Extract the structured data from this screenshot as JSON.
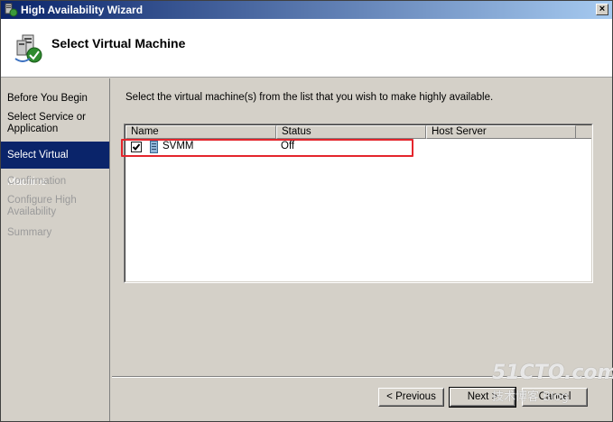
{
  "window": {
    "title": "High Availability Wizard",
    "close_glyph": "×"
  },
  "header": {
    "title": "Select Virtual Machine",
    "icon": "wizard-server-icon"
  },
  "sidebar": {
    "items": [
      {
        "label": "Before You Begin",
        "state": "normal"
      },
      {
        "label": "Select Service or Application",
        "state": "normal"
      },
      {
        "label": "Select Virtual Machine",
        "state": "active"
      },
      {
        "label": "Confirmation",
        "state": "disabled"
      },
      {
        "label": "Configure High Availability",
        "state": "disabled"
      },
      {
        "label": "Summary",
        "state": "disabled"
      }
    ]
  },
  "main": {
    "instruction": "Select the virtual machine(s) from the list that you wish to make highly available.",
    "list": {
      "columns": [
        "Name",
        "Status",
        "Host Server"
      ],
      "rows": [
        {
          "checked": true,
          "name": "SVMM",
          "status": "Off",
          "host_server": ""
        }
      ]
    }
  },
  "buttons": {
    "previous": "< Previous",
    "next": "Next >",
    "cancel": "Cancel"
  },
  "watermark": {
    "logo": "51CTO.com",
    "sub": "技术博客  Blog"
  },
  "colors": {
    "accent": "#0a246a",
    "highlight_box": "#e4252c",
    "window_bg": "#d4d0c8"
  }
}
